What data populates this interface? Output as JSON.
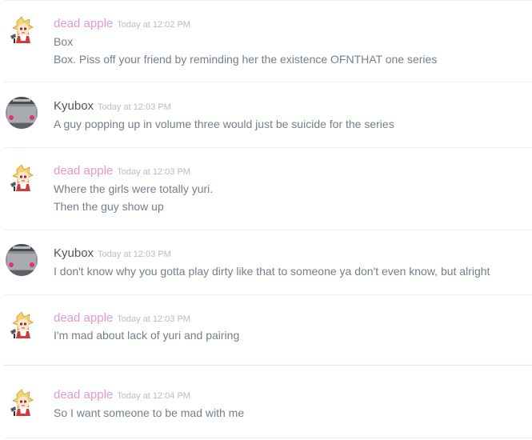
{
  "colors": {
    "dead_apple_name": "#e498c8",
    "kyubox_name": "#4f545c",
    "message_text": "#737f8d",
    "timestamp": "#b9bbbe"
  },
  "messages": [
    {
      "author": "dead apple",
      "avatar": "anime-girl-avatar",
      "timestamp": "Today at 12:02 PM",
      "lines": [
        "Box",
        "Box.  Piss off your friend by reminding her the existence OFNTHAT one series"
      ]
    },
    {
      "author": "Kyubox",
      "avatar": "device-avatar",
      "timestamp": "Today at 12:03 PM",
      "lines": [
        "A guy popping up in volume three would just be suicide for the series"
      ]
    },
    {
      "author": "dead apple",
      "avatar": "anime-girl-avatar",
      "timestamp": "Today at 12:03 PM",
      "lines": [
        "Where the girls were totally yuri.",
        "Then the guy show up"
      ]
    },
    {
      "author": "Kyubox",
      "avatar": "device-avatar",
      "timestamp": "Today at 12:03 PM",
      "lines": [
        "I don't know why you gotta play dirty like that to someone ya don't even know, but alright"
      ]
    },
    {
      "author": "dead apple",
      "avatar": "anime-girl-avatar",
      "timestamp": "Today at 12:03 PM",
      "lines": [
        "I'm mad about lack of yuri and pairing"
      ]
    },
    {
      "author": "dead apple",
      "avatar": "anime-girl-avatar",
      "timestamp": "Today at 12:04 PM",
      "lines": [
        "So I want someone to be mad with me"
      ]
    }
  ]
}
